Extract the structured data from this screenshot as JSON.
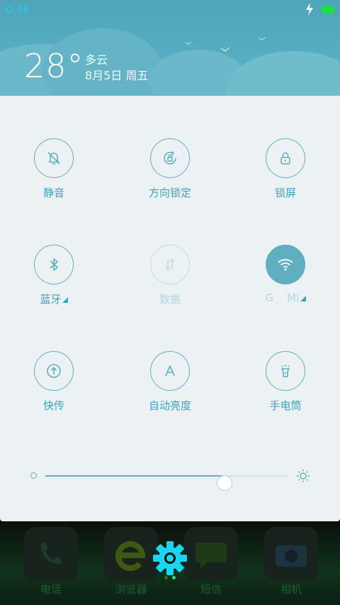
{
  "status_bar": {
    "time": "0:36",
    "battery_color": "#19e53a",
    "charging_icon": "bolt-icon"
  },
  "weather": {
    "temperature": "28°",
    "condition": "多云",
    "date": "8月5日 周五"
  },
  "quick_settings": {
    "tiles": [
      {
        "label": "静音",
        "icon": "bell-muted-icon",
        "state": "off"
      },
      {
        "label": "方向锁定",
        "icon": "rotation-lock-icon",
        "state": "off"
      },
      {
        "label": "锁屏",
        "icon": "lock-icon",
        "state": "off"
      },
      {
        "label": "蓝牙",
        "icon": "bluetooth-icon",
        "state": "off",
        "has_menu": true
      },
      {
        "label": "数据",
        "icon": "data-transfer-icon",
        "state": "disabled"
      },
      {
        "label": "G    MI",
        "icon": "wifi-icon",
        "state": "on",
        "has_menu": true
      },
      {
        "label": "快传",
        "icon": "share-upload-icon",
        "state": "off"
      },
      {
        "label": "自动亮度",
        "icon": "auto-brightness-icon",
        "state": "off"
      },
      {
        "label": "手电筒",
        "icon": "flashlight-icon",
        "state": "off"
      }
    ]
  },
  "brightness": {
    "level": 0.74
  },
  "dock": {
    "apps": [
      {
        "label": "电话",
        "icon": "phone-icon"
      },
      {
        "label": "浏览器",
        "icon": "browser-icon"
      },
      {
        "label": "短信",
        "icon": "message-icon"
      },
      {
        "label": "相机",
        "icon": "camera-icon"
      }
    ],
    "floating_icon": "settings-gear-icon"
  },
  "colors": {
    "accent": "#62aec1",
    "label": "#3fa2bb",
    "header": "#56adc0"
  }
}
